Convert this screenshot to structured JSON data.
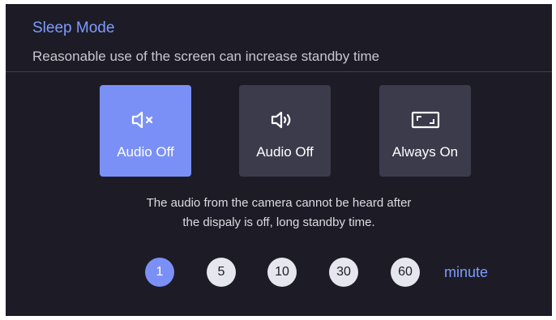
{
  "header": {
    "title": "Sleep Mode",
    "subtitle": "Reasonable use of the screen can increase standby time"
  },
  "modes": [
    {
      "label": "Audio Off",
      "icon": "speaker-muted-icon",
      "selected": true
    },
    {
      "label": "Audio Off",
      "icon": "speaker-sound-icon",
      "selected": false
    },
    {
      "label": "Always On",
      "icon": "screen-frame-icon",
      "selected": false
    }
  ],
  "description": {
    "line1": "The audio from the camera cannot be heard after",
    "line2": "the dispaly is off, long standby time."
  },
  "timer": {
    "options": [
      "1",
      "5",
      "10",
      "30",
      "60"
    ],
    "selected": "1",
    "unit": "minute"
  },
  "colors": {
    "background": "#1d1c26",
    "accent": "#7b90f7",
    "tile": "#3b3b4c",
    "chip": "#e6e6ee"
  }
}
